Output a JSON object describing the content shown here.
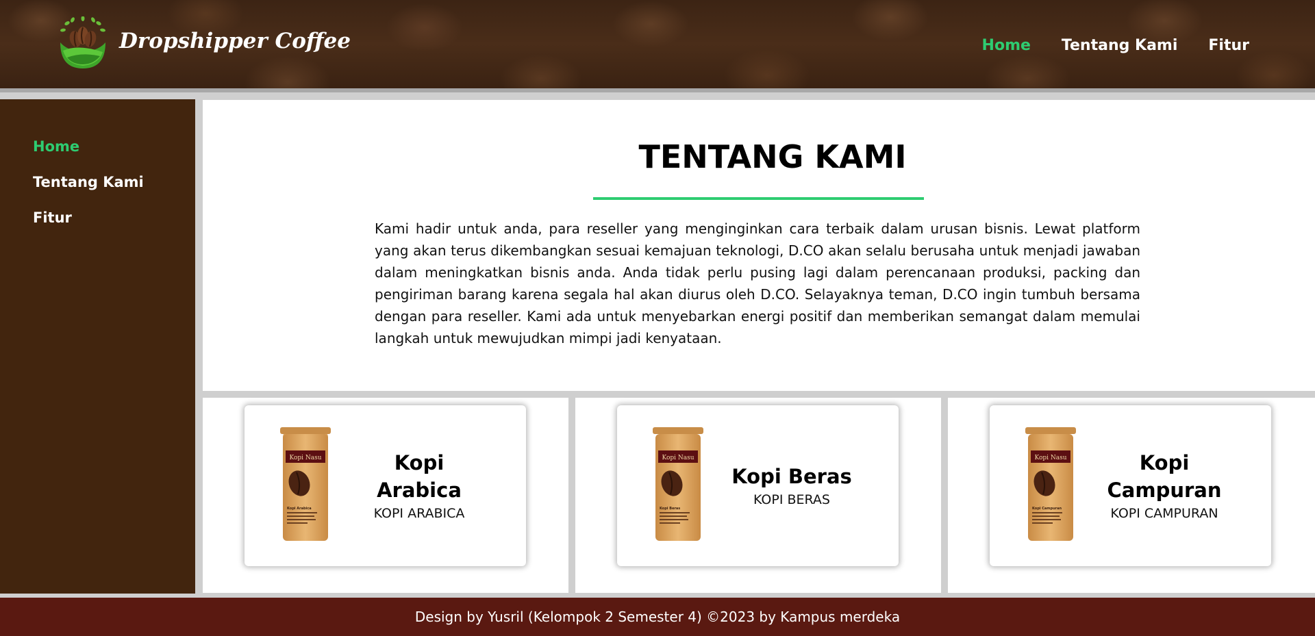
{
  "header": {
    "brand": "Dropshipper Coffee",
    "nav": [
      {
        "label": "Home",
        "active": true
      },
      {
        "label": "Tentang Kami",
        "active": false
      },
      {
        "label": "Fitur",
        "active": false
      }
    ]
  },
  "sidebar": {
    "items": [
      {
        "label": "Home",
        "active": true
      },
      {
        "label": "Tentang Kami",
        "active": false
      },
      {
        "label": "Fitur",
        "active": false
      }
    ]
  },
  "about": {
    "title": "TENTANG KAMI",
    "body": "Kami hadir untuk anda, para reseller yang menginginkan cara terbaik dalam urusan bisnis. Lewat platform yang akan terus dikembangkan sesuai kemajuan teknologi, D.CO akan selalu berusaha untuk menjadi jawaban dalam meningkatkan bisnis anda. Anda tidak perlu pusing lagi dalam perencanaan produksi, packing dan pengiriman barang karena segala hal akan diurus oleh D.CO. Selayaknya teman, D.CO ingin tumbuh bersama dengan para reseller. Kami ada untuk menyebarkan energi positif dan memberikan semangat dalam memulai langkah untuk mewujudkan mimpi jadi kenyataan."
  },
  "products": [
    {
      "title": "Kopi Arabica",
      "subtitle": "KOPI ARABICA",
      "bag_brand": "Kopi Nasu",
      "bag_label": "Kopi Arabica"
    },
    {
      "title": "Kopi Beras",
      "subtitle": "KOPI BERAS",
      "bag_brand": "Kopi Nasu",
      "bag_label": "Kopi Beras"
    },
    {
      "title": "Kopi Campuran",
      "subtitle": "KOPI CAMPURAN",
      "bag_brand": "Kopi Nasu",
      "bag_label": "Kopi Campuran"
    }
  ],
  "footer": {
    "text": "Design by Yusril (Kelompok 2 Semester 4) ©2023 by Kampus merdeka"
  },
  "colors": {
    "accent": "#2ecc71",
    "sidebar": "#42250e",
    "footer": "#5a1911",
    "header": "#4a2d19"
  },
  "icons": {
    "logo": "coffee-bean-leaf-logo",
    "product": "coffee-bag-image"
  }
}
